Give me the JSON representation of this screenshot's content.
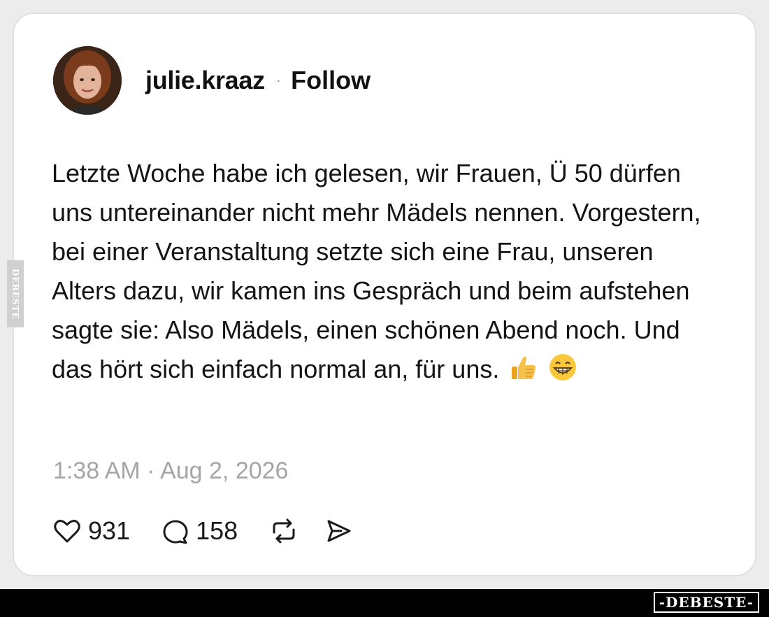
{
  "post": {
    "username": "julie.kraaz",
    "separator": "·",
    "follow_label": "Follow",
    "text": "Letzte Woche habe ich gelesen, wir Frauen, Ü 50 dürfen uns untereinander nicht mehr Mädels nennen. Vorgestern, bei einer Veranstaltung setzte sich eine Frau, unseren Alters dazu, wir kamen ins Gespräch und beim aufstehen sagte sie: Also Mädels, einen schönen Abend noch. Und das hört sich einfach normal an, für uns.",
    "emojis": [
      "thumbs-up-emoji",
      "grinning-face-emoji"
    ],
    "timestamp": "1:38 AM · Aug 2, 2026",
    "likes": "931",
    "replies": "158",
    "icons": {
      "like": "heart-icon",
      "reply": "speech-bubble-icon",
      "repost": "repost-icon",
      "share": "send-icon"
    }
  },
  "watermark": {
    "side": "DEBESTE",
    "brand": "-DEBESTE-"
  }
}
